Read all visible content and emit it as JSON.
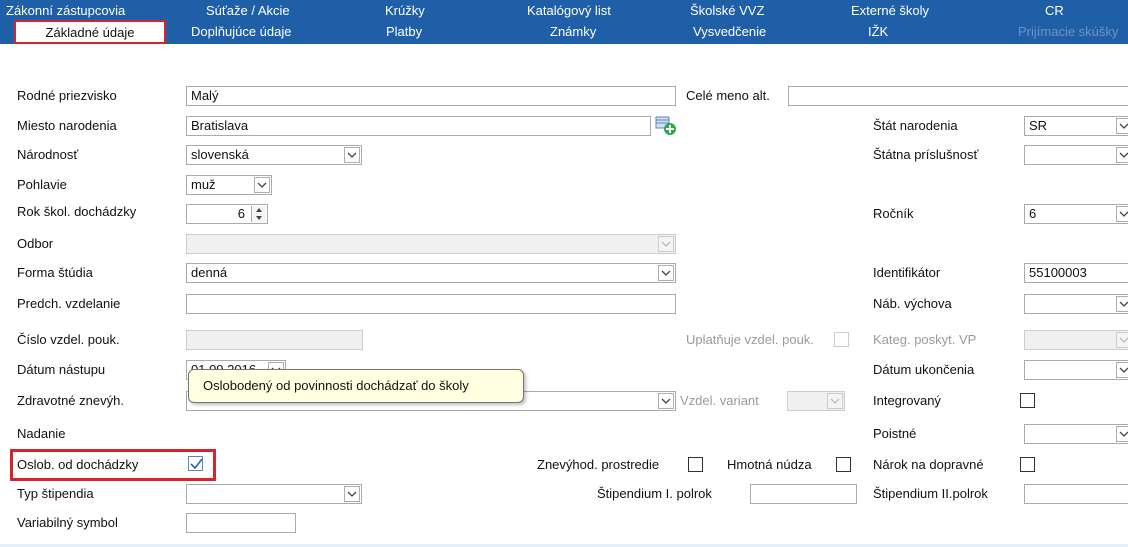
{
  "tabs": {
    "row1": [
      "Zákonní zástupcovia",
      "Súťaže / Akcie",
      "Krúžky",
      "Katalógový list",
      "Školské VVZ",
      "Externé školy",
      "CR"
    ],
    "row2": [
      "Základné údaje",
      "Doplňujúce údaje",
      "Platby",
      "Známky",
      "Vysvedčenie",
      "IŽK",
      "Prijímacie skúšky"
    ],
    "active": "Základné údaje"
  },
  "labels": {
    "rodne_priezvisko": "Rodné priezvisko",
    "miesto_narodenia": "Miesto narodenia",
    "narodnost": "Národnosť",
    "pohlavie": "Pohlavie",
    "rok_skol": "Rok škol. dochádzky",
    "odbor": "Odbor",
    "forma_studia": "Forma štúdia",
    "predch_vzdelanie": "Predch. vzdelanie",
    "cislo_vzdel_pouk": "Číslo vzdel. pouk.",
    "datum_nastupu": "Dátum nástupu",
    "zdravotne": "Zdravotné znevýh.",
    "nadanie": "Nadanie",
    "oslob": "Oslob. od dochádzky",
    "typ_stipendia": "Typ štipendia",
    "variabilny_symbol": "Variabilný symbol",
    "cele_meno_alt": "Celé meno alt.",
    "uplatnuje": "Uplatňuje vzdel. pouk.",
    "vzdel_variant": "Vzdel. variant",
    "znevyhod_prostredie": "Znevýhod. prostredie",
    "hmotna_nudza": "Hmotná núdza",
    "stipendium_1": "Štipendium I. polrok",
    "stat_narodenia": "Štát narodenia",
    "statna_prislusnost": "Štátna príslušnosť",
    "rocnik": "Ročník",
    "identifikator": "Identifikátor",
    "nab_vychova": "Náb. výchova",
    "kateg_poskyt": "Kateg. poskyt. VP",
    "datum_ukoncenia": "Dátum ukončenia",
    "integrovany": "Integrovaný",
    "poistne": "Poistné",
    "narok_dopravne": "Nárok na dopravné",
    "stipendium_2": "Štipendium II.polrok"
  },
  "values": {
    "rodne_priezvisko": "Malý",
    "miesto_narodenia": "Bratislava",
    "narodnost": "slovenská",
    "pohlavie": "muž",
    "rok_skol": "6",
    "forma_studia": "denná",
    "datum_nastupu": "01.09.2016",
    "stat_narodenia": "SR",
    "rocnik": "6",
    "identifikator": "55100003"
  },
  "checkboxes": {
    "oslob": true,
    "uplatnuje": false,
    "znevyhod_prostredie": false,
    "hmotna_nudza": false,
    "integrovany": false,
    "narok_dopravne": false
  },
  "tooltip": "Oslobodený od povinnosti dochádzať do školy",
  "colors": {
    "tab_bar": "#1f5fa8",
    "highlight": "#d7232b",
    "tooltip_bg": "#ffffe1"
  }
}
